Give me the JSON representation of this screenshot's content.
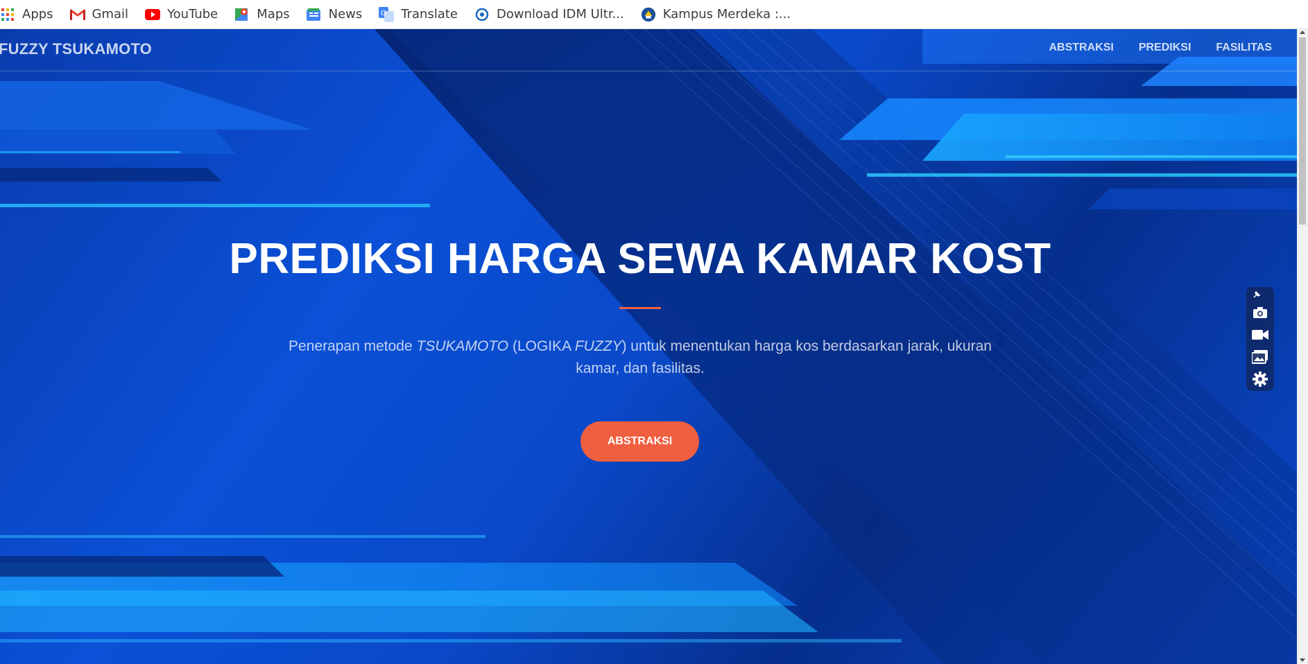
{
  "bookmarks": [
    {
      "label": "Apps",
      "icon": "apps-grid-icon"
    },
    {
      "label": "Gmail",
      "icon": "gmail-icon"
    },
    {
      "label": "YouTube",
      "icon": "youtube-icon"
    },
    {
      "label": "Maps",
      "icon": "maps-icon"
    },
    {
      "label": "News",
      "icon": "news-icon"
    },
    {
      "label": "Translate",
      "icon": "translate-icon"
    },
    {
      "label": "Download IDM Ultr...",
      "icon": "idm-icon"
    },
    {
      "label": "Kampus Merdeka :...",
      "icon": "kampus-merdeka-icon"
    }
  ],
  "navbar": {
    "brand": "FUZZY TSUKAMOTO",
    "links": [
      "ABSTRAKSI",
      "PREDIKSI",
      "FASILITAS"
    ]
  },
  "hero": {
    "title": "PREDIKSI HARGA SEWA KAMAR KOST",
    "subtitle": {
      "p1": "Penerapan metode ",
      "em1": "TSUKAMOTO",
      "p2": " (LOGIKA ",
      "em2": "FUZZY",
      "p3": ") untuk menentukan harga kos berdasarkan jarak, ukuran kamar, dan fasilitas."
    },
    "cta": "ABSTRAKSI"
  },
  "toolbar": {
    "icons": [
      "pin-icon",
      "camera-icon",
      "video-icon",
      "gallery-icon",
      "settings-gear-icon"
    ]
  },
  "colors": {
    "accent": "#f05f40",
    "hero_blue": "#0b4fd4"
  }
}
